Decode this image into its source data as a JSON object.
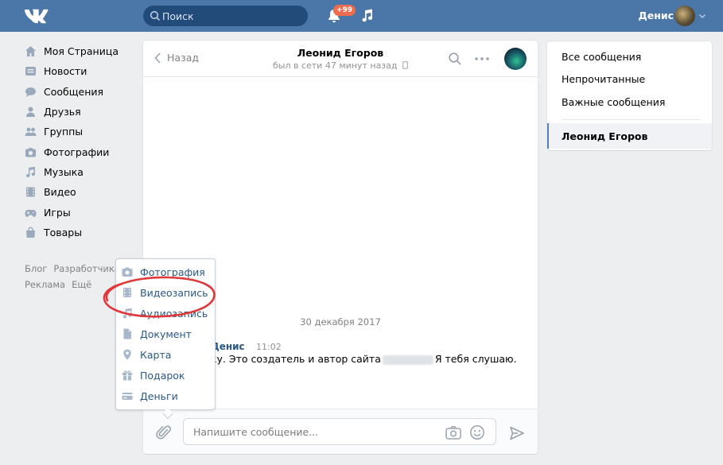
{
  "colors": {
    "header": "#4a76a8",
    "link": "#2a5885",
    "accent": "#5181b8",
    "badge": "#ef6c4e",
    "ring": "#e0383a"
  },
  "header": {
    "search_placeholder": "Поиск",
    "notifications_badge": "+99",
    "user_name": "Денис"
  },
  "sidebar": {
    "items": [
      {
        "label": "Моя Страница",
        "icon": "home-icon"
      },
      {
        "label": "Новости",
        "icon": "news-icon"
      },
      {
        "label": "Сообщения",
        "icon": "messages-icon"
      },
      {
        "label": "Друзья",
        "icon": "friends-icon"
      },
      {
        "label": "Группы",
        "icon": "groups-icon"
      },
      {
        "label": "Фотографии",
        "icon": "camera-icon"
      },
      {
        "label": "Музыка",
        "icon": "music-icon"
      },
      {
        "label": "Видео",
        "icon": "video-icon"
      },
      {
        "label": "Игры",
        "icon": "gamepad-icon"
      },
      {
        "label": "Товары",
        "icon": "bag-icon"
      }
    ],
    "footer_links": [
      "Блог",
      "Разработчикам",
      "Реклама",
      "Ещё"
    ]
  },
  "chat": {
    "back_label": "Назад",
    "peer_name": "Леонид Егоров",
    "peer_status": "был в сети 47 минут назад",
    "date_separator": "30 декабря 2017",
    "message": {
      "author": "Денис",
      "time": "11:02",
      "text_before": "ку. Это создатель и автор сайта",
      "text_after": "Я тебя слушаю."
    },
    "input_placeholder": "Напишите сообщение..."
  },
  "attach_menu": {
    "items": [
      {
        "label": "Фотография",
        "icon": "photo-icon"
      },
      {
        "label": "Видеозапись",
        "icon": "video-icon"
      },
      {
        "label": "Аудиозапись",
        "icon": "audio-icon"
      },
      {
        "label": "Документ",
        "icon": "document-icon"
      },
      {
        "label": "Карта",
        "icon": "map-pin-icon"
      },
      {
        "label": "Подарок",
        "icon": "gift-icon"
      },
      {
        "label": "Деньги",
        "icon": "money-icon"
      }
    ]
  },
  "right_panel": {
    "all_messages": "Все сообщения",
    "unread": "Непрочитанные",
    "important": "Важные сообщения",
    "active_dialog": "Леонид Егоров"
  }
}
